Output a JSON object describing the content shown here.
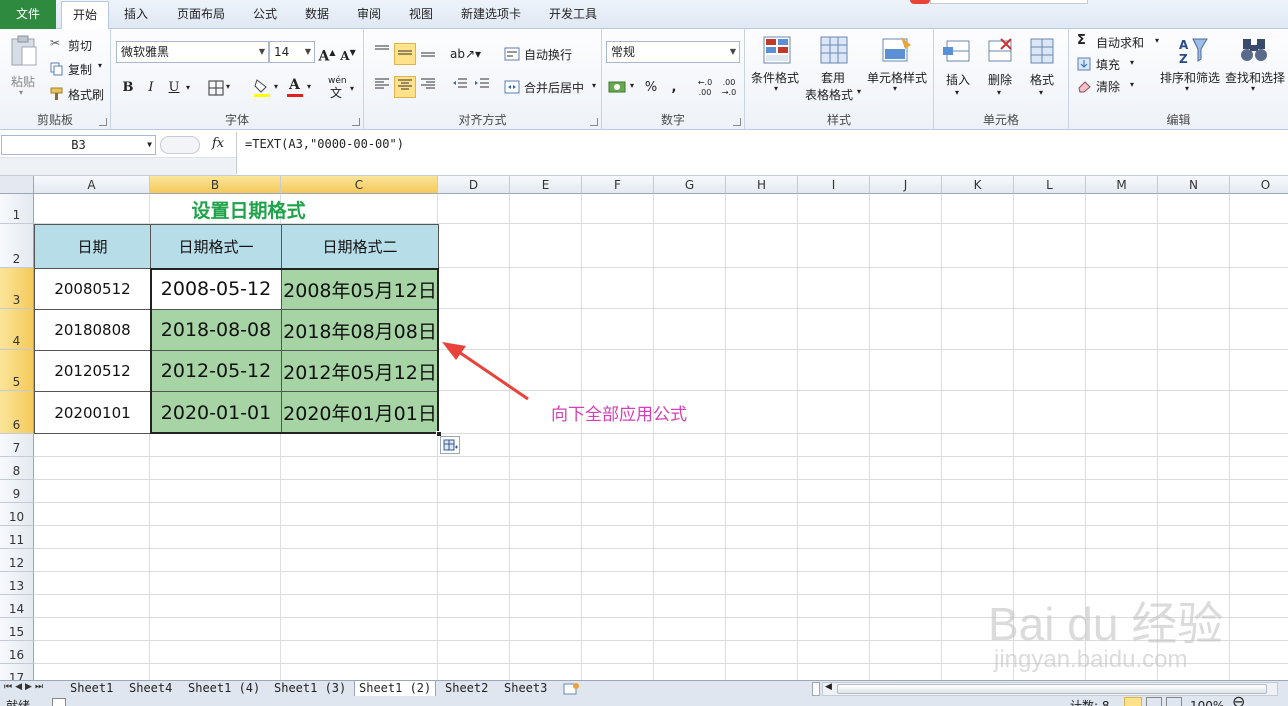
{
  "ribbon_tabs": [
    "文件",
    "开始",
    "插入",
    "页面布局",
    "公式",
    "数据",
    "审阅",
    "视图",
    "新建选项卡",
    "开发工具"
  ],
  "clipboard": {
    "paste": "粘贴",
    "cut": "剪切",
    "copy": "复制",
    "format_painter": "格式刷",
    "label": "剪贴板"
  },
  "font": {
    "name": "微软雅黑",
    "size": "14",
    "grow": "A",
    "shrink": "A",
    "bold": "B",
    "italic": "I",
    "underline": "U",
    "pinyin": "wén",
    "label": "字体"
  },
  "alignment": {
    "wrap": "自动换行",
    "merge": "合并后居中",
    "label": "对齐方式"
  },
  "number": {
    "format": "常规",
    "percent": "%",
    "comma": ",",
    "inc_decimal": "←.0 .00",
    "dec_decimal": ".00 →.0",
    "label": "数字"
  },
  "styles": {
    "conditional": "条件格式",
    "table_line1": "套用",
    "table_line2": "表格格式",
    "cell_styles": "单元格样式",
    "label": "样式"
  },
  "cells": {
    "insert": "插入",
    "delete": "删除",
    "format": "格式",
    "label": "单元格"
  },
  "editing": {
    "autosum": "自动求和",
    "fill": "填充",
    "clear": "清除",
    "sort_filter": "排序和筛选",
    "find_select": "查找和选择",
    "label": "编辑"
  },
  "formula_bar": {
    "name_box": "B3",
    "fx": "fx",
    "formula": "=TEXT(A3,\"0000-00-00\")"
  },
  "columns": [
    "A",
    "B",
    "C",
    "D",
    "E",
    "F",
    "G",
    "H",
    "I",
    "J",
    "K",
    "L",
    "M",
    "N",
    "O"
  ],
  "rows": [
    "1",
    "2",
    "3",
    "4",
    "5",
    "6",
    "7",
    "8",
    "9",
    "10",
    "11",
    "12",
    "13",
    "14",
    "15",
    "16",
    "17"
  ],
  "sheet": {
    "title": "设置日期格式",
    "headers": [
      "日期",
      "日期格式一",
      "日期格式二"
    ],
    "data": [
      [
        "20080512",
        "2008-05-12",
        "2008年05月12日"
      ],
      [
        "20180808",
        "2018-08-08",
        "2018年08月08日"
      ],
      [
        "20120512",
        "2012-05-12",
        "2012年05月12日"
      ],
      [
        "20200101",
        "2020-01-01",
        "2020年01月01日"
      ]
    ]
  },
  "annotation": "向下全部应用公式",
  "watermark": {
    "brand": "Bai du 经验",
    "url": "jingyan.baidu.com"
  },
  "sheet_tabs": [
    "Sheet1",
    "Sheet4",
    "Sheet1 (4)",
    "Sheet1 (3)",
    "Sheet1 (2)",
    "Sheet2",
    "Sheet3"
  ],
  "active_sheet": "Sheet1 (2)",
  "status": {
    "ready": "就绪",
    "count": "计数: 8",
    "zoom": "100%"
  },
  "colors": {
    "accent_green": "#2d8a3e",
    "header_fill": "#b7dde8",
    "data_fill": "#a6d4a5",
    "title": "#1fa34a",
    "annotation": "#d63fb5",
    "arrow": "#e8423a"
  }
}
